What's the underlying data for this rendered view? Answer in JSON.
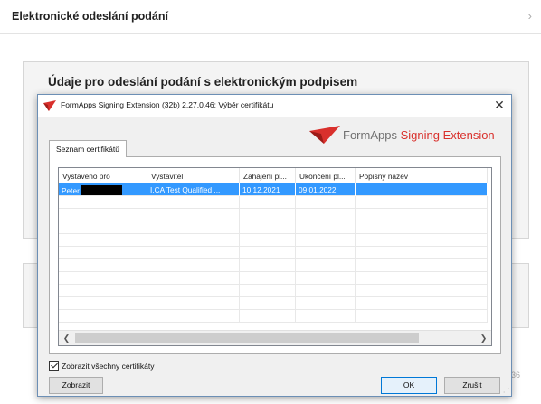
{
  "page": {
    "title": "Elektronické odeslání podání",
    "panel_title": "Údaje pro odeslání podání s elektronickým podpisem",
    "side_number": "36"
  },
  "dialog": {
    "title": "FormApps Signing Extension (32b) 2.27.0.46: Výběr certifikátu",
    "brand_form": "FormApps",
    "brand_signing": "Signing Extension",
    "brand_color": "#d9302c",
    "tab_label": "Seznam certifikátů",
    "columns": [
      "Vystaveno pro",
      "Vystavitel",
      "Zahájení pl...",
      "Ukončení pl...",
      "Popisný název"
    ],
    "rows": [
      {
        "issued_to": "Peter",
        "issuer": "I.CA Test Qualified ...",
        "valid_from": "10.12.2021",
        "valid_to": "09.01.2022",
        "friendly_name": ""
      }
    ],
    "show_all_checkbox": "Zobrazit všechny certifikáty",
    "show_all_checked": true,
    "show_button": "Zobrazit",
    "ok_button": "OK",
    "cancel_button": "Zrušit"
  }
}
